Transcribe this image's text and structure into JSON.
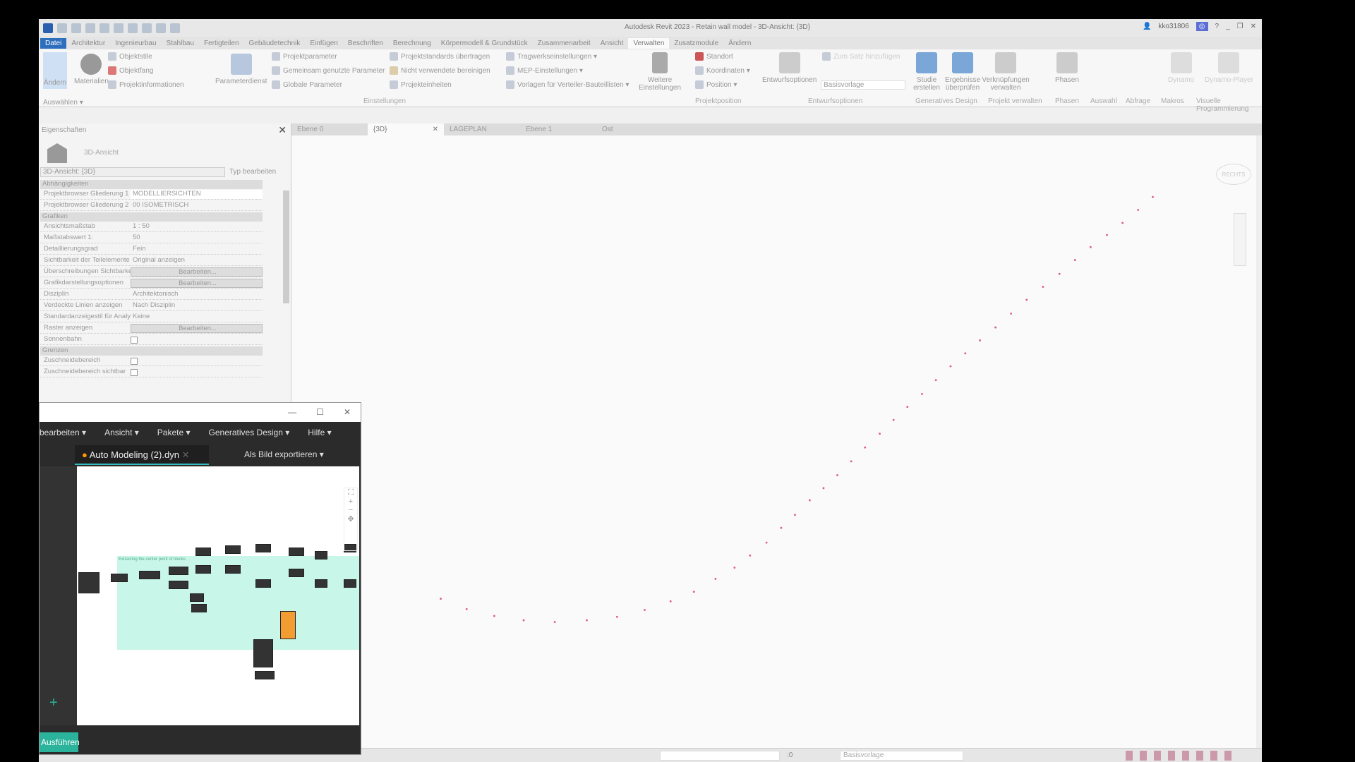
{
  "titlebar": {
    "title": "Autodesk Revit 2023 - Retain wall model - 3D-Ansicht: {3D}",
    "user": "kko31806"
  },
  "ribbon_tabs": [
    "Datei",
    "Architektur",
    "Ingenieurbau",
    "Stahlbau",
    "Fertigteilen",
    "Gebäudetechnik",
    "Einfügen",
    "Beschriften",
    "Berechnung",
    "Körpermodell & Grundstück",
    "Zusammenarbeit",
    "Ansicht",
    "Verwalten",
    "Zusatzmodule",
    "Ändern"
  ],
  "active_tab": "Verwalten",
  "ribbon": {
    "aendern": "Ändern",
    "auswaehlen": "Auswählen ▾",
    "materialien": "Materialien",
    "objektstile": "Objektstile",
    "objektfang": "Objektfang",
    "projektinformationen": "Projektinformationen",
    "parameterdienst": "Parameterdienst",
    "projektparameter": "Projektparameter",
    "gemeinsam": "Gemeinsam genutzte Parameter",
    "globale": "Globale Parameter",
    "standards": "Projektstandards übertragen",
    "bereinigen": "Nicht verwendete bereinigen",
    "einheiten": "Projekteinheiten",
    "tragwerk": "Tragwerkseinstellungen ▾",
    "mep": "MEP-Einstellungen ▾",
    "vorlagen": "Vorlagen für Verteiler-Bauteillisten ▾",
    "weitere": "Weitere Einstellungen",
    "standort": "Standort",
    "koordinaten": "Koordinaten ▾",
    "position": "Position ▾",
    "entwurfsoptionen": "Entwurfsoptionen",
    "zum_satz": "Zum Satz hinzufügen",
    "basisvorlage": "Basisvorlage",
    "studie": "Studie erstellen",
    "ergebnisse": "Ergebnisse überprüfen",
    "verknuepfungen": "Verknüpfungen verwalten",
    "phasen": "Phasen",
    "dynamo": "Dynamo",
    "dynamo_player": "Dynamo-Player",
    "groups": [
      "Auswählen",
      "Einstellungen",
      "Projektposition",
      "Entwurfsoptionen",
      "Generatives Design",
      "Projekt verwalten",
      "Phasen",
      "Auswahl",
      "Abfrage",
      "Makros",
      "Visuelle Programmierung"
    ]
  },
  "properties": {
    "title": "Eigenschaften",
    "type_name": "3D-Ansicht",
    "selector": "3D-Ansicht: {3D}",
    "edit_type": "Typ bearbeiten",
    "sections": {
      "abh": "Abhängigkeiten",
      "graf": "Grafiken",
      "grenzen": "Grenzen"
    },
    "rows": [
      {
        "k": "Projektbrowser Gliederung 1",
        "v": "MODELLIERSICHTEN"
      },
      {
        "k": "Projektbrowser Gliederung 2",
        "v": "00 ISOMETRISCH"
      },
      {
        "k": "Ansichtsmaßstab",
        "v": "1 : 50"
      },
      {
        "k": "Maßstabswert 1:",
        "v": "50"
      },
      {
        "k": "Detaillierungsgrad",
        "v": "Fein"
      },
      {
        "k": "Sichtbarkeit der Teilelemente",
        "v": "Original anzeigen"
      },
      {
        "k": "Überschreibungen Sichtbarkeit/Gr...",
        "v": "Bearbeiten..."
      },
      {
        "k": "Grafikdarstellungsoptionen",
        "v": "Bearbeiten..."
      },
      {
        "k": "Disziplin",
        "v": "Architektonisch"
      },
      {
        "k": "Verdeckte Linien anzeigen",
        "v": "Nach Disziplin"
      },
      {
        "k": "Standardanzeigestil für Analyse",
        "v": "Keine"
      },
      {
        "k": "Raster anzeigen",
        "v": "Bearbeiten..."
      },
      {
        "k": "Sonnenbahn",
        "v": ""
      },
      {
        "k": "Zuschneidebereich",
        "v": ""
      },
      {
        "k": "Zuschneidebereich sichtbar",
        "v": ""
      }
    ]
  },
  "view_tabs": [
    "Ebene 0",
    "{3D}",
    "LAGEPLAN",
    "Ebene 1",
    "Ost"
  ],
  "active_view": "{3D}",
  "viewcube": "RECHTS",
  "status": {
    "workset": "Basisvorlage",
    "zero": ":0"
  },
  "dynamo": {
    "menus": [
      "bearbeiten ▾",
      "Ansicht ▾",
      "Pakete ▾",
      "Generatives Design ▾",
      "Hilfe ▾"
    ],
    "file": "Auto Modeling (2).dyn",
    "export": "Als Bild exportieren ▾",
    "run": "Ausführen",
    "group_title": "Extracting the center point of blocks"
  },
  "colors": {
    "file_tab": "#2d6fbd",
    "points": "#e05a7a",
    "run": "#2bb39b",
    "group": "#c8f7ea"
  }
}
